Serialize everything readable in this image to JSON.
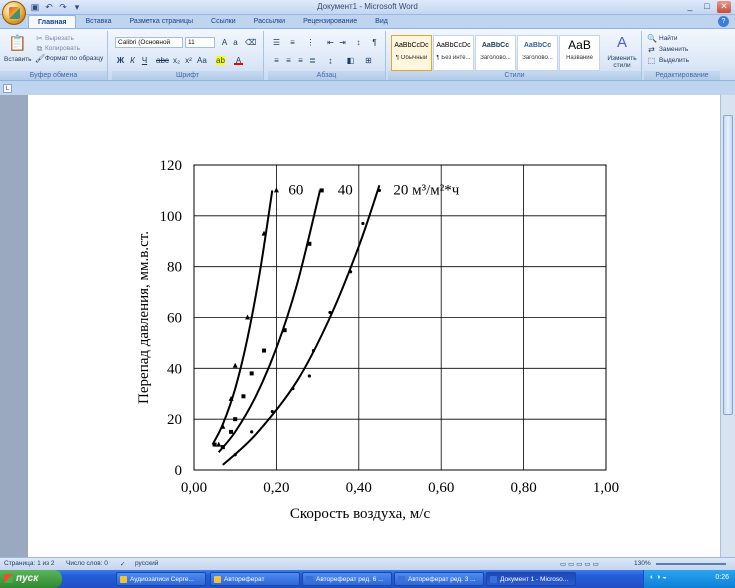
{
  "window": {
    "title": "Документ1 - Microsoft Word"
  },
  "tabs": [
    "Главная",
    "Вставка",
    "Разметка страницы",
    "Ссылки",
    "Рассылки",
    "Рецензирование",
    "Вид"
  ],
  "ribbon": {
    "clipboard": {
      "label": "Буфер обмена",
      "paste": "Вставить",
      "cut": "Вырезать",
      "copy": "Копировать",
      "format_painter": "Формат по образцу"
    },
    "font": {
      "label": "Шрифт",
      "name": "Calibri (Основной текст)",
      "size": "11"
    },
    "paragraph": {
      "label": "Абзац"
    },
    "styles": {
      "label": "Стили",
      "items": [
        {
          "sample": "AaBbCcDc",
          "name": "¶ Обычный"
        },
        {
          "sample": "AaBbCcDc",
          "name": "¶ Без инте..."
        },
        {
          "sample": "AaBbCc",
          "name": "Заголово..."
        },
        {
          "sample": "AaBbCc",
          "name": "Заголово..."
        },
        {
          "sample": "AaB",
          "name": "Название"
        }
      ],
      "change_styles": "Изменить стили"
    },
    "editing": {
      "label": "Редактирование",
      "find": "Найти",
      "replace": "Заменить",
      "select": "Выделить"
    }
  },
  "chart_data": {
    "type": "scatter",
    "xlabel": "Скорость воздуха, м/с",
    "ylabel": "Перепад давления, мм.в.ст.",
    "xlim": [
      0,
      1
    ],
    "ylim": [
      0,
      120
    ],
    "xticks": [
      "0,00",
      "0,20",
      "0,40",
      "0,60",
      "0,80",
      "1,00"
    ],
    "yticks": [
      "0",
      "20",
      "40",
      "60",
      "80",
      "100",
      "120"
    ],
    "grid": true,
    "series": [
      {
        "name": "60",
        "marker": "triangle",
        "points": [
          [
            0.06,
            10
          ],
          [
            0.07,
            17
          ],
          [
            0.09,
            28
          ],
          [
            0.1,
            41
          ],
          [
            0.13,
            60
          ],
          [
            0.17,
            93
          ],
          [
            0.2,
            110
          ]
        ],
        "curve": [
          [
            0.045,
            10
          ],
          [
            0.07,
            18
          ],
          [
            0.1,
            32
          ],
          [
            0.13,
            52
          ],
          [
            0.16,
            78
          ],
          [
            0.19,
            110
          ]
        ]
      },
      {
        "name": "40",
        "marker": "square",
        "points": [
          [
            0.05,
            10
          ],
          [
            0.07,
            9
          ],
          [
            0.09,
            15
          ],
          [
            0.1,
            20
          ],
          [
            0.12,
            29
          ],
          [
            0.14,
            38
          ],
          [
            0.17,
            47
          ],
          [
            0.22,
            55
          ],
          [
            0.28,
            89
          ],
          [
            0.31,
            110
          ]
        ],
        "curve": [
          [
            0.06,
            7
          ],
          [
            0.1,
            15
          ],
          [
            0.15,
            29
          ],
          [
            0.2,
            48
          ],
          [
            0.25,
            73
          ],
          [
            0.3,
            106
          ],
          [
            0.305,
            110
          ]
        ]
      },
      {
        "name": "20 м³/м²*ч",
        "marker": "dot",
        "points": [
          [
            0.1,
            6
          ],
          [
            0.14,
            15
          ],
          [
            0.19,
            23
          ],
          [
            0.24,
            32
          ],
          [
            0.28,
            37
          ],
          [
            0.29,
            47
          ],
          [
            0.33,
            62
          ],
          [
            0.38,
            78
          ],
          [
            0.41,
            97
          ],
          [
            0.45,
            110
          ]
        ],
        "curve": [
          [
            0.07,
            2
          ],
          [
            0.15,
            14
          ],
          [
            0.25,
            35
          ],
          [
            0.33,
            60
          ],
          [
            0.4,
            88
          ],
          [
            0.45,
            112
          ]
        ]
      }
    ]
  },
  "status": {
    "page": "Страница: 1 из 2",
    "words": "Число слов: 0",
    "language": "русский",
    "zoom": "130%"
  },
  "taskbar": {
    "start": "пуск",
    "tasks": [
      "Аудиозаписи Серге...",
      "Автореферат",
      "Автореферат ред. 6 ...",
      "Автореферат ред. 3 ...",
      "Документ 1 - Microso..."
    ],
    "clock": "0:26"
  }
}
